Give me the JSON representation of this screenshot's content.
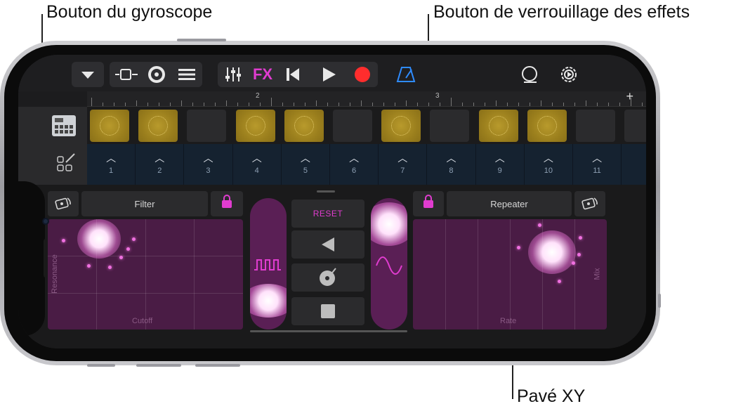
{
  "callouts": {
    "gyro": "Bouton du gyroscope",
    "lock": "Bouton de verrouillage des effets",
    "xypad": "Pavé XY"
  },
  "toolbar": {
    "icons": [
      "chevron-down-icon",
      "tracks-view-icon",
      "browser-icon",
      "track-controls-icon",
      "mixer-icon",
      "fx-button",
      "go-to-start-icon",
      "play-icon",
      "record-icon",
      "metronome-icon",
      "loop-browser-icon",
      "settings-icon"
    ],
    "fx_label": "FX"
  },
  "ruler": {
    "labels": [
      "2",
      "3"
    ],
    "plus": "+"
  },
  "pads": {
    "states": [
      true,
      true,
      false,
      true,
      true,
      false,
      true,
      false,
      true,
      true,
      false,
      false
    ]
  },
  "steps": {
    "numbers": [
      "1",
      "2",
      "3",
      "4",
      "5",
      "6",
      "7",
      "8",
      "9",
      "10",
      "11"
    ]
  },
  "left_fx": {
    "title": "Filter",
    "x_axis": "Cutoff",
    "y_axis": "Resonance"
  },
  "right_fx": {
    "title": "Repeater",
    "x_axis": "Rate",
    "y_axis": "Mix"
  },
  "center": {
    "reset_label": "RESET"
  },
  "colors": {
    "accent": "#e03ccf",
    "pad_bg": "#4a1c45",
    "cell_on": "#9b7f1d",
    "record": "#ff2d2d",
    "metronome": "#2f8cff"
  }
}
